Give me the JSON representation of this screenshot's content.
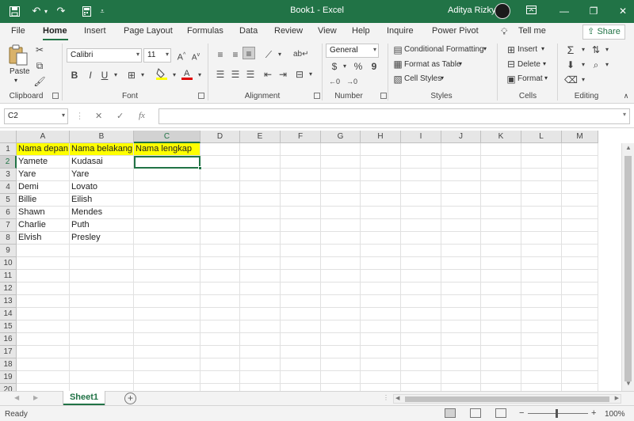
{
  "window": {
    "title": "Book1 - Excel",
    "user": "Aditya Rizky",
    "icons": [
      "save-icon",
      "undo-icon",
      "redo-icon",
      "calculator-icon",
      "customize-icon",
      "ribbon-display-icon",
      "minimize-icon",
      "restore-icon",
      "close-icon"
    ]
  },
  "ribbon_tabs": [
    "File",
    "Home",
    "Insert",
    "Page Layout",
    "Formulas",
    "Data",
    "Review",
    "View",
    "Help",
    "Inquire",
    "Power Pivot"
  ],
  "active_tab": "Home",
  "tell_me": "Tell me",
  "share_label": "Share",
  "ribbon": {
    "clipboard": {
      "paste": "Paste",
      "label": "Clipboard"
    },
    "font": {
      "name": "Calibri",
      "size": "11",
      "label": "Font",
      "bold": "B",
      "italic": "I",
      "underline": "U"
    },
    "alignment": {
      "label": "Alignment"
    },
    "number": {
      "format": "General",
      "label": "Number",
      "percent": "%",
      "comma": "9"
    },
    "styles": {
      "conditional": "Conditional Formatting",
      "format_table": "Format as Table",
      "cell_styles": "Cell Styles",
      "label": "Styles"
    },
    "cells": {
      "insert": "Insert",
      "delete": "Delete",
      "format": "Format",
      "label": "Cells"
    },
    "editing": {
      "label": "Editing"
    }
  },
  "formula_bar": {
    "name_box": "C2",
    "formula": ""
  },
  "columns": [
    "A",
    "B",
    "C",
    "D",
    "E",
    "F",
    "G",
    "H",
    "I",
    "J",
    "K",
    "L",
    "M"
  ],
  "rows": [
    "1",
    "2",
    "3",
    "4",
    "5",
    "6",
    "7",
    "8",
    "9",
    "10",
    "11",
    "12",
    "13",
    "14",
    "15",
    "16",
    "17",
    "18",
    "19",
    "20"
  ],
  "cells": {
    "A1": "Nama depan",
    "B1": "Nama belakang",
    "C1": "Nama lengkap",
    "A2": "Yamete",
    "B2": "Kudasai",
    "A3": "Yare",
    "B3": "Yare",
    "A4": "Demi",
    "B4": "Lovato",
    "A5": "Billie",
    "B5": "Eilish",
    "A6": "Shawn",
    "B6": "Mendes",
    "A7": "Charlie",
    "B7": "Puth",
    "A8": "Elvish",
    "B8": "Presley"
  },
  "highlight_color": "#ffff00",
  "accent_color": "#217346",
  "active_cell": "C2",
  "sheet_tabs": [
    "Sheet1"
  ],
  "status": {
    "ready": "Ready",
    "zoom": "100%"
  }
}
